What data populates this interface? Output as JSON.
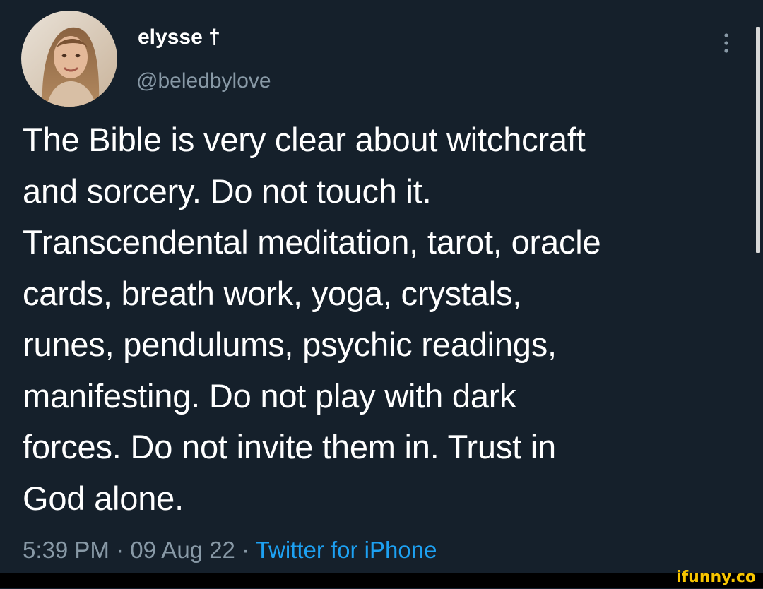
{
  "tweet": {
    "display_name": "elysse †",
    "handle": "@beledbylove",
    "text_lines": [
      "The Bible is very clear about witchcraft",
      "and sorcery. Do not touch it.",
      "Transcendental meditation, tarot, oracle",
      "cards, breath work, yoga, crystals,",
      "runes, pendulums, psychic readings,",
      "manifesting. Do not play with dark",
      "forces. Do not invite them in. Trust in",
      "God alone."
    ],
    "time": "5:39 PM",
    "date": "09 Aug 22",
    "separator": "·",
    "source": "Twitter for iPhone"
  },
  "watermark": {
    "text": "ifunny.co"
  },
  "colors": {
    "background": "#15202b",
    "text": "#ffffff",
    "secondary": "#8899a6",
    "link": "#1da1f2",
    "watermark": "#f7c500"
  },
  "icons": {
    "avatar": "user-avatar",
    "more": "more-vertical-icon"
  }
}
